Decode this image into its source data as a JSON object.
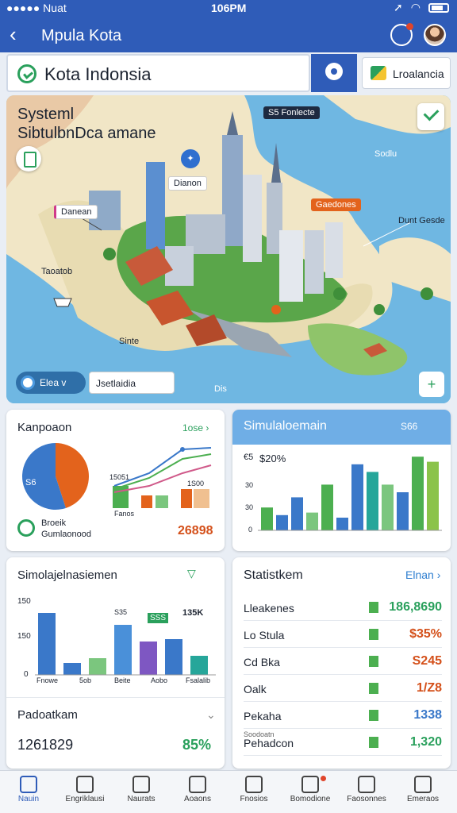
{
  "status": {
    "left": "●●●●● Nuat",
    "time": "106PM"
  },
  "header": {
    "title": "Mpula Kota"
  },
  "search": {
    "text": "Kota Indonsia"
  },
  "lang_button": {
    "label": "Lroalancia"
  },
  "map": {
    "title_line1": "Systeml",
    "title_line2": "SibtulbnDca amane",
    "tags": {
      "dark": "S5 Fonlecte",
      "blue": "Dianon",
      "white": "Danean",
      "orange": "Gaedones",
      "east": "Dunt Gesde",
      "northeast": "Sodlu",
      "west": "Taoatob",
      "south": "Sinte",
      "bottom": "Dis"
    },
    "pill_label": "Elea v",
    "legend_label": "Jsetlaidia",
    "locate_symbol": "+"
  },
  "card_comparison": {
    "title": "Kanpoaon",
    "link": "1ose ›",
    "legend_line1": "Broeik",
    "legend_line2": "Gumlaonood",
    "total": "26898",
    "pie_label": "S6",
    "mini_axis": [
      "15051",
      "1S00"
    ],
    "mini_xlabel": "Fanos",
    "chart_data": {
      "type": "pie",
      "slices": [
        {
          "name": "orange",
          "value": 45,
          "color": "#e3631c"
        },
        {
          "name": "blue",
          "value": 55,
          "color": "#3a78c9"
        }
      ]
    }
  },
  "card_simulation": {
    "title": "Simulaloemain",
    "link": "S66",
    "ylabel_top": "$20%",
    "ylabel_top_prefix": "€5",
    "ticks": [
      "30",
      "30",
      "0"
    ],
    "chart_data": {
      "type": "bar",
      "values": [
        18,
        12,
        26,
        14,
        36,
        10,
        52,
        46,
        36,
        30,
        58,
        54
      ],
      "colors": [
        "#4caf50",
        "#3a78c9",
        "#3a78c9",
        "#7bc67e",
        "#4caf50",
        "#3a78c9",
        "#3a78c9",
        "#26a69a",
        "#7bc67e",
        "#3a78c9",
        "#4caf50",
        "#8bc34a"
      ],
      "ylim": [
        0,
        60
      ]
    }
  },
  "card_simple": {
    "title": "Simolajelnasiemen",
    "ticks": [
      "150",
      "150",
      "0"
    ],
    "xlabels": [
      "Fnowe",
      "5ob",
      "Beite",
      "Aobo",
      "Fsalalib"
    ],
    "bar_labels": [
      "S35",
      "SSS",
      "135K"
    ],
    "chart_data": {
      "type": "bar",
      "values": [
        130,
        25,
        35,
        105,
        70,
        75,
        40
      ],
      "colors": [
        "#3a78c9",
        "#3a78c9",
        "#7bc67e",
        "#4a90d9",
        "#7e57c2",
        "#3a78c9",
        "#26a69a"
      ],
      "ylim": [
        0,
        150
      ]
    },
    "pad_title": "Padoatkam",
    "pad_number": "1261829",
    "pad_percent": "85%"
  },
  "card_stats": {
    "title": "Statistkem",
    "link": "Elnan ›",
    "rows": [
      {
        "name": "Lleakenes",
        "value": "186,8690",
        "color": "#2aa05c"
      },
      {
        "name": "Lo Stula",
        "value": "$35%",
        "color": "#d4501a"
      },
      {
        "name": "Cd Bka",
        "value": "S245",
        "color": "#d4501a"
      },
      {
        "name": "Oalk",
        "value": "1/Z8",
        "color": "#d4501a"
      },
      {
        "name": "Pekaha",
        "value": "1338",
        "color": "#3a78c9"
      },
      {
        "name": "Pehadcon",
        "value": "1,320",
        "color": "#2aa05c"
      }
    ],
    "sublabel": "Soodoatn"
  },
  "nav": [
    {
      "label": "Nauin",
      "icon": "home-icon",
      "active": true
    },
    {
      "label": "Engriklausi",
      "icon": "upload-icon"
    },
    {
      "label": "Naurats",
      "icon": "grid-icon"
    },
    {
      "label": "Aoaons",
      "icon": "badge-icon"
    },
    {
      "label": "Fnosios",
      "icon": "user-icon"
    },
    {
      "label": "Bomodione",
      "icon": "doc-icon"
    },
    {
      "label": "Faosonnes",
      "icon": "group-icon"
    },
    {
      "label": "Emeraos",
      "icon": "person-icon"
    }
  ]
}
